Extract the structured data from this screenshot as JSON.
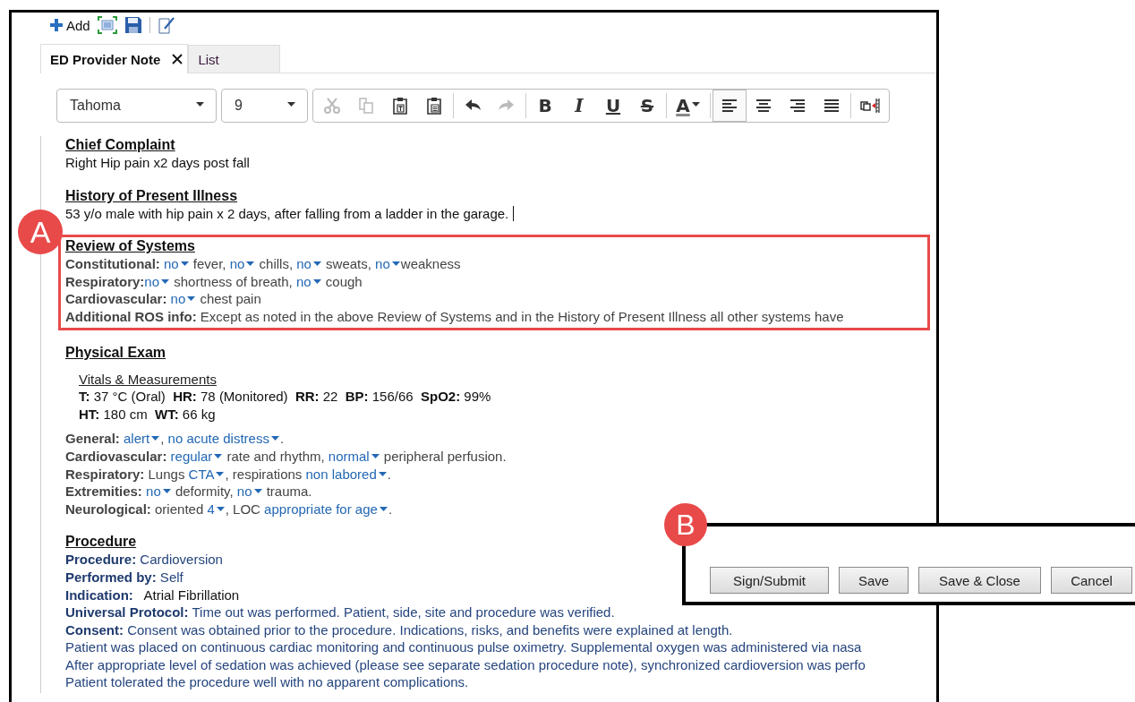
{
  "toolbar": [
    {
      "kind": "add",
      "label": "Add"
    },
    {
      "kind": "expand"
    },
    {
      "kind": "save"
    },
    {
      "kind": "edit"
    }
  ],
  "tabs": [
    {
      "label": "ED Provider Note",
      "selected": true,
      "closable": true
    },
    {
      "label": "List",
      "selected": false,
      "closable": false
    }
  ],
  "format_bar": {
    "font": "Tahoma",
    "size": "9",
    "buttons": [
      {
        "kind": "cut",
        "disabled": true,
        "selected": false
      },
      {
        "kind": "copy",
        "disabled": true,
        "selected": false
      },
      {
        "kind": "paste-text",
        "disabled": false,
        "selected": false
      },
      {
        "kind": "paste-list",
        "disabled": false,
        "selected": false
      },
      {
        "kind": "sep"
      },
      {
        "kind": "undo",
        "disabled": false,
        "selected": false
      },
      {
        "kind": "redo",
        "disabled": true,
        "selected": false
      },
      {
        "kind": "sep"
      },
      {
        "kind": "bold",
        "label": "B",
        "disabled": false,
        "selected": false
      },
      {
        "kind": "italic",
        "label": "I",
        "disabled": false,
        "selected": false
      },
      {
        "kind": "underline",
        "label": "U",
        "disabled": false,
        "selected": false
      },
      {
        "kind": "strike",
        "label": "S",
        "disabled": false,
        "selected": false
      },
      {
        "kind": "sep"
      },
      {
        "kind": "color",
        "label": "A",
        "disabled": false,
        "selected": false
      },
      {
        "kind": "sep"
      },
      {
        "kind": "align-left",
        "disabled": false,
        "selected": true
      },
      {
        "kind": "align-center",
        "disabled": false,
        "selected": false
      },
      {
        "kind": "align-right",
        "disabled": false,
        "selected": false
      },
      {
        "kind": "justify",
        "disabled": false,
        "selected": false
      },
      {
        "kind": "sep"
      },
      {
        "kind": "table",
        "disabled": false,
        "selected": false
      }
    ]
  },
  "sections": [
    {
      "heading": "Chief Complaint",
      "lines": [
        {
          "kind": "plain",
          "text": "Right Hip pain x2 days post fall",
          "cursor": false
        }
      ]
    },
    {
      "heading": "History of Present Illness",
      "lines": [
        {
          "kind": "plain",
          "text": "53 y/o male with hip pain x 2 days, after falling from a ladder in the garage.",
          "cursor": true
        }
      ]
    },
    {
      "heading": "Review of Systems",
      "annotation": "A",
      "lines": [
        {
          "kind": "field",
          "segments": [
            {
              "kind": "label",
              "text": "Constitutional: "
            },
            {
              "kind": "pick",
              "text": "no"
            },
            {
              "kind": "text",
              "text": " fever, "
            },
            {
              "kind": "pick",
              "text": "no"
            },
            {
              "kind": "text",
              "text": " chills, "
            },
            {
              "kind": "pick",
              "text": "no"
            },
            {
              "kind": "text",
              "text": " sweats, "
            },
            {
              "kind": "pick",
              "text": "no"
            },
            {
              "kind": "text",
              "text": "weakness"
            }
          ]
        },
        {
          "kind": "field",
          "segments": [
            {
              "kind": "label",
              "text": "Respiratory:"
            },
            {
              "kind": "pick",
              "text": "no"
            },
            {
              "kind": "text",
              "text": " shortness of breath, "
            },
            {
              "kind": "pick",
              "text": "no"
            },
            {
              "kind": "text",
              "text": " cough"
            }
          ]
        },
        {
          "kind": "field",
          "segments": [
            {
              "kind": "label",
              "text": "Cardiovascular: "
            },
            {
              "kind": "pick",
              "text": "no"
            },
            {
              "kind": "text",
              "text": " chest pain"
            }
          ]
        },
        {
          "kind": "field",
          "segments": [
            {
              "kind": "label",
              "text": "Additional ROS info:"
            },
            {
              "kind": "text",
              "text": " Except as noted in the above Review of Systems and in the History of Present Illness all other systems have"
            }
          ]
        }
      ]
    },
    {
      "heading": "Physical Exam",
      "lines": [
        {
          "kind": "subheading",
          "text": "Vitals & Measurements"
        },
        {
          "kind": "vitals",
          "segments": [
            {
              "kind": "label",
              "text": "T:"
            },
            {
              "kind": "text",
              "text": " 37 °C (Oral)  "
            },
            {
              "kind": "label",
              "text": "HR:"
            },
            {
              "kind": "text",
              "text": " 78 (Monitored)  "
            },
            {
              "kind": "label",
              "text": "RR:"
            },
            {
              "kind": "text",
              "text": " 22  "
            },
            {
              "kind": "label",
              "text": "BP:"
            },
            {
              "kind": "text",
              "text": " 156/66  "
            },
            {
              "kind": "label",
              "text": "SpO2:"
            },
            {
              "kind": "text",
              "text": " 99%"
            }
          ]
        },
        {
          "kind": "vitals",
          "segments": [
            {
              "kind": "label",
              "text": "HT:"
            },
            {
              "kind": "text",
              "text": " 180 cm  "
            },
            {
              "kind": "label",
              "text": "WT:"
            },
            {
              "kind": "text",
              "text": " 66 kg"
            }
          ]
        },
        {
          "kind": "field",
          "segments": [
            {
              "kind": "label",
              "text": "General: "
            },
            {
              "kind": "pick",
              "text": "alert"
            },
            {
              "kind": "text",
              "text": ", "
            },
            {
              "kind": "pick",
              "text": "no acute distress"
            },
            {
              "kind": "text",
              "text": "."
            }
          ]
        },
        {
          "kind": "field",
          "segments": [
            {
              "kind": "label",
              "text": "Cardiovascular: "
            },
            {
              "kind": "pick",
              "text": "regular"
            },
            {
              "kind": "text",
              "text": " rate and rhythm, "
            },
            {
              "kind": "pick",
              "text": "normal"
            },
            {
              "kind": "text",
              "text": " peripheral perfusion."
            }
          ]
        },
        {
          "kind": "field",
          "segments": [
            {
              "kind": "label",
              "text": "Respiratory:"
            },
            {
              "kind": "text",
              "text": " Lungs "
            },
            {
              "kind": "pick",
              "text": "CTA"
            },
            {
              "kind": "text",
              "text": ", respirations "
            },
            {
              "kind": "pick",
              "text": "non labored"
            },
            {
              "kind": "text",
              "text": "."
            }
          ]
        },
        {
          "kind": "field",
          "segments": [
            {
              "kind": "label",
              "text": "Extremities: "
            },
            {
              "kind": "pick",
              "text": "no"
            },
            {
              "kind": "text",
              "text": " deformity, "
            },
            {
              "kind": "pick",
              "text": "no"
            },
            {
              "kind": "text",
              "text": " trauma."
            }
          ]
        },
        {
          "kind": "field",
          "segments": [
            {
              "kind": "label",
              "text": "Neurological:"
            },
            {
              "kind": "text",
              "text": " oriented "
            },
            {
              "kind": "pick",
              "text": "4"
            },
            {
              "kind": "text",
              "text": ", LOC "
            },
            {
              "kind": "pick",
              "text": "appropriate for age"
            },
            {
              "kind": "text",
              "text": "."
            }
          ]
        }
      ]
    },
    {
      "heading": "Procedure",
      "lines": [
        {
          "kind": "procedure",
          "segments": [
            {
              "kind": "label",
              "text": "Procedure:"
            },
            {
              "kind": "text",
              "text": " Cardioversion"
            }
          ]
        },
        {
          "kind": "procedure",
          "segments": [
            {
              "kind": "label",
              "text": "Performed by:"
            },
            {
              "kind": "text",
              "text": " Self"
            }
          ]
        },
        {
          "kind": "procedure",
          "segments": [
            {
              "kind": "label",
              "text": "Indication:"
            },
            {
              "kind": "value",
              "text": "   Atrial Fibrillation"
            }
          ]
        },
        {
          "kind": "procedure",
          "segments": [
            {
              "kind": "label",
              "text": "Universal Protocol:"
            },
            {
              "kind": "text",
              "text": " Time out was performed. Patient, side, site and procedure was verified."
            }
          ]
        },
        {
          "kind": "procedure",
          "segments": [
            {
              "kind": "label",
              "text": "Consent:"
            },
            {
              "kind": "text",
              "text": " Consent was obtained prior to the procedure. Indications, risks, and benefits were explained at length."
            }
          ]
        },
        {
          "kind": "procedure",
          "segments": [
            {
              "kind": "text",
              "text": "Patient was placed on continuous cardiac monitoring and continuous pulse oximetry. Supplemental oxygen was administered via nasa"
            }
          ]
        },
        {
          "kind": "procedure",
          "segments": [
            {
              "kind": "text",
              "text": "After appropriate level of sedation was achieved (please see separate sedation procedure note), synchronized cardioversion was perfo"
            }
          ]
        },
        {
          "kind": "procedure",
          "segments": [
            {
              "kind": "text",
              "text": "Patient tolerated the procedure well with no apparent complications."
            }
          ]
        }
      ]
    }
  ],
  "action_panel": {
    "annotation": "B",
    "buttons": [
      "Sign/Submit",
      "Save",
      "Save & Close",
      "Cancel"
    ]
  }
}
